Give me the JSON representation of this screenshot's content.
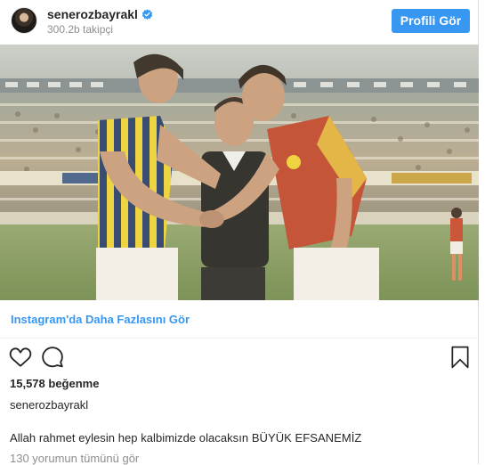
{
  "header": {
    "username": "senerozbayrakl",
    "verified_icon": "verified-badge-icon",
    "followers": "300.2b takipçi",
    "profile_button": "Profili Gör"
  },
  "post": {
    "image_description_icon": "vintage-football-handshake-photo",
    "more_link": "Instagram'da Daha Fazlasını Gör",
    "likes": "15,578 beğenme",
    "caption_user": "senerozbayrakl",
    "caption_text": "Allah rahmet eylesin hep kalbimizde olacaksın BÜYÜK EFSANEMİZ",
    "comments_link": "130 yorumun tümünü gör"
  },
  "actions": {
    "like_icon": "heart-icon",
    "comment_icon": "comment-bubble-icon",
    "save_icon": "bookmark-icon"
  },
  "colors": {
    "accent": "#3897f0",
    "muted": "#8e8e8e",
    "text": "#262626"
  }
}
